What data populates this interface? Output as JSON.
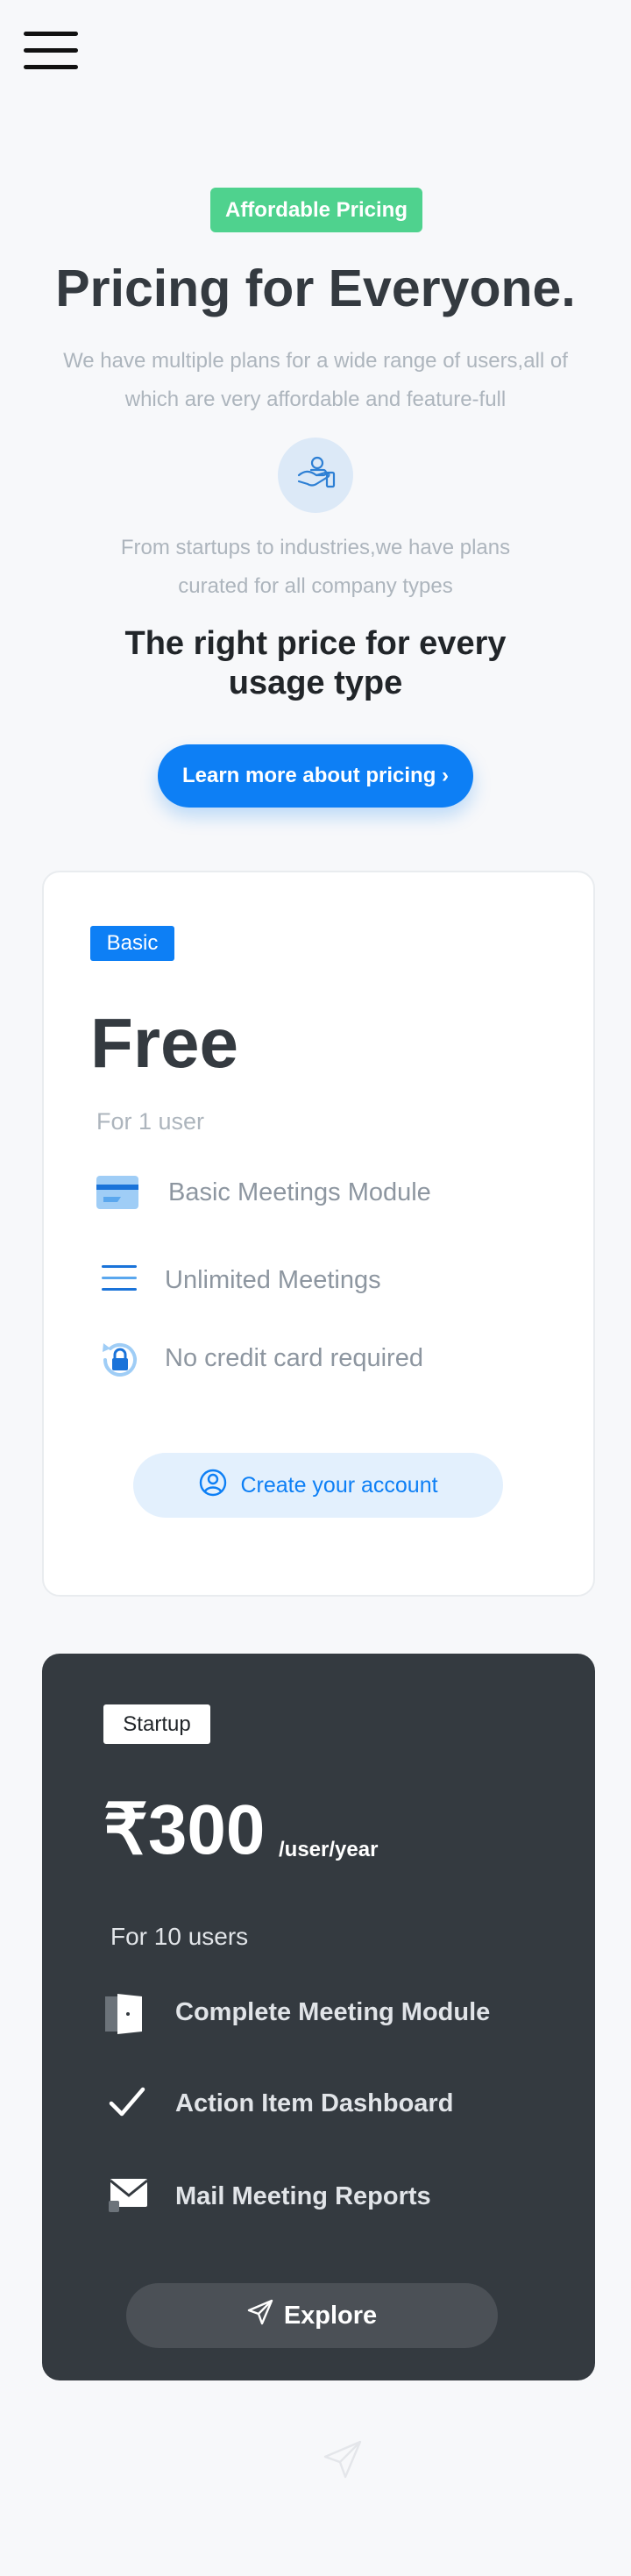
{
  "header": {
    "menu_icon": "hamburger-icon"
  },
  "hero": {
    "badge": "Affordable Pricing",
    "title": "Pricing for Everyone.",
    "subtitle": "We have multiple plans for a wide range of users,all of which are very affordable and feature-full",
    "icon": "hand-coin-icon",
    "description": "From startups to industries,we have plans curated for all company types",
    "tagline": "The right price for every usage type",
    "cta_label": "Learn more about pricing ›"
  },
  "plans": {
    "basic": {
      "tag": "Basic",
      "price": "Free",
      "users": "For 1 user",
      "features": [
        {
          "label": "Basic Meetings Module",
          "icon": "card-icon"
        },
        {
          "label": "Unlimited Meetings",
          "icon": "list-icon"
        },
        {
          "label": "No credit card required",
          "icon": "lock-refresh-icon"
        }
      ],
      "cta_label": "Create your account",
      "cta_icon": "user-circle-icon"
    },
    "startup": {
      "tag": "Startup",
      "price": "₹300",
      "period": "/user/year",
      "users": "For 10 users",
      "features": [
        {
          "label": "Complete Meeting Module",
          "icon": "door-icon"
        },
        {
          "label": "Action Item Dashboard",
          "icon": "check-icon"
        },
        {
          "label": "Mail Meeting Reports",
          "icon": "mail-icon"
        }
      ],
      "cta_label": "Explore",
      "cta_icon": "paper-plane-icon"
    }
  },
  "colors": {
    "accent": "#0d7ff5",
    "badge_green": "#4fd28e",
    "dark_card": "#343a40"
  }
}
